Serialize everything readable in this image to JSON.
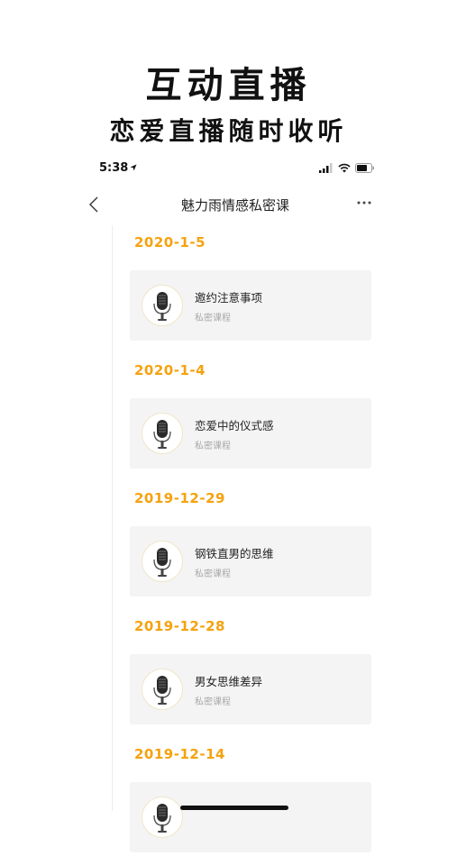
{
  "promo": {
    "title": "互动直播",
    "subtitle": "恋爱直播随时收听"
  },
  "status_bar": {
    "time": "5:38"
  },
  "nav": {
    "title": "魅力雨情感私密课"
  },
  "groups": [
    {
      "date": "2020-1-5",
      "course": {
        "title": "邀约注意事项",
        "tag": "私密课程"
      }
    },
    {
      "date": "2020-1-4",
      "course": {
        "title": "恋爱中的仪式感",
        "tag": "私密课程"
      }
    },
    {
      "date": "2019-12-29",
      "course": {
        "title": "钢铁直男的思维",
        "tag": "私密课程"
      }
    },
    {
      "date": "2019-12-28",
      "course": {
        "title": "男女思维差异",
        "tag": "私密课程"
      }
    },
    {
      "date": "2019-12-14",
      "course": {
        "title": "",
        "tag": ""
      }
    }
  ],
  "colors": {
    "accent": "#f5a20f",
    "card_bg": "#f4f4f4"
  }
}
